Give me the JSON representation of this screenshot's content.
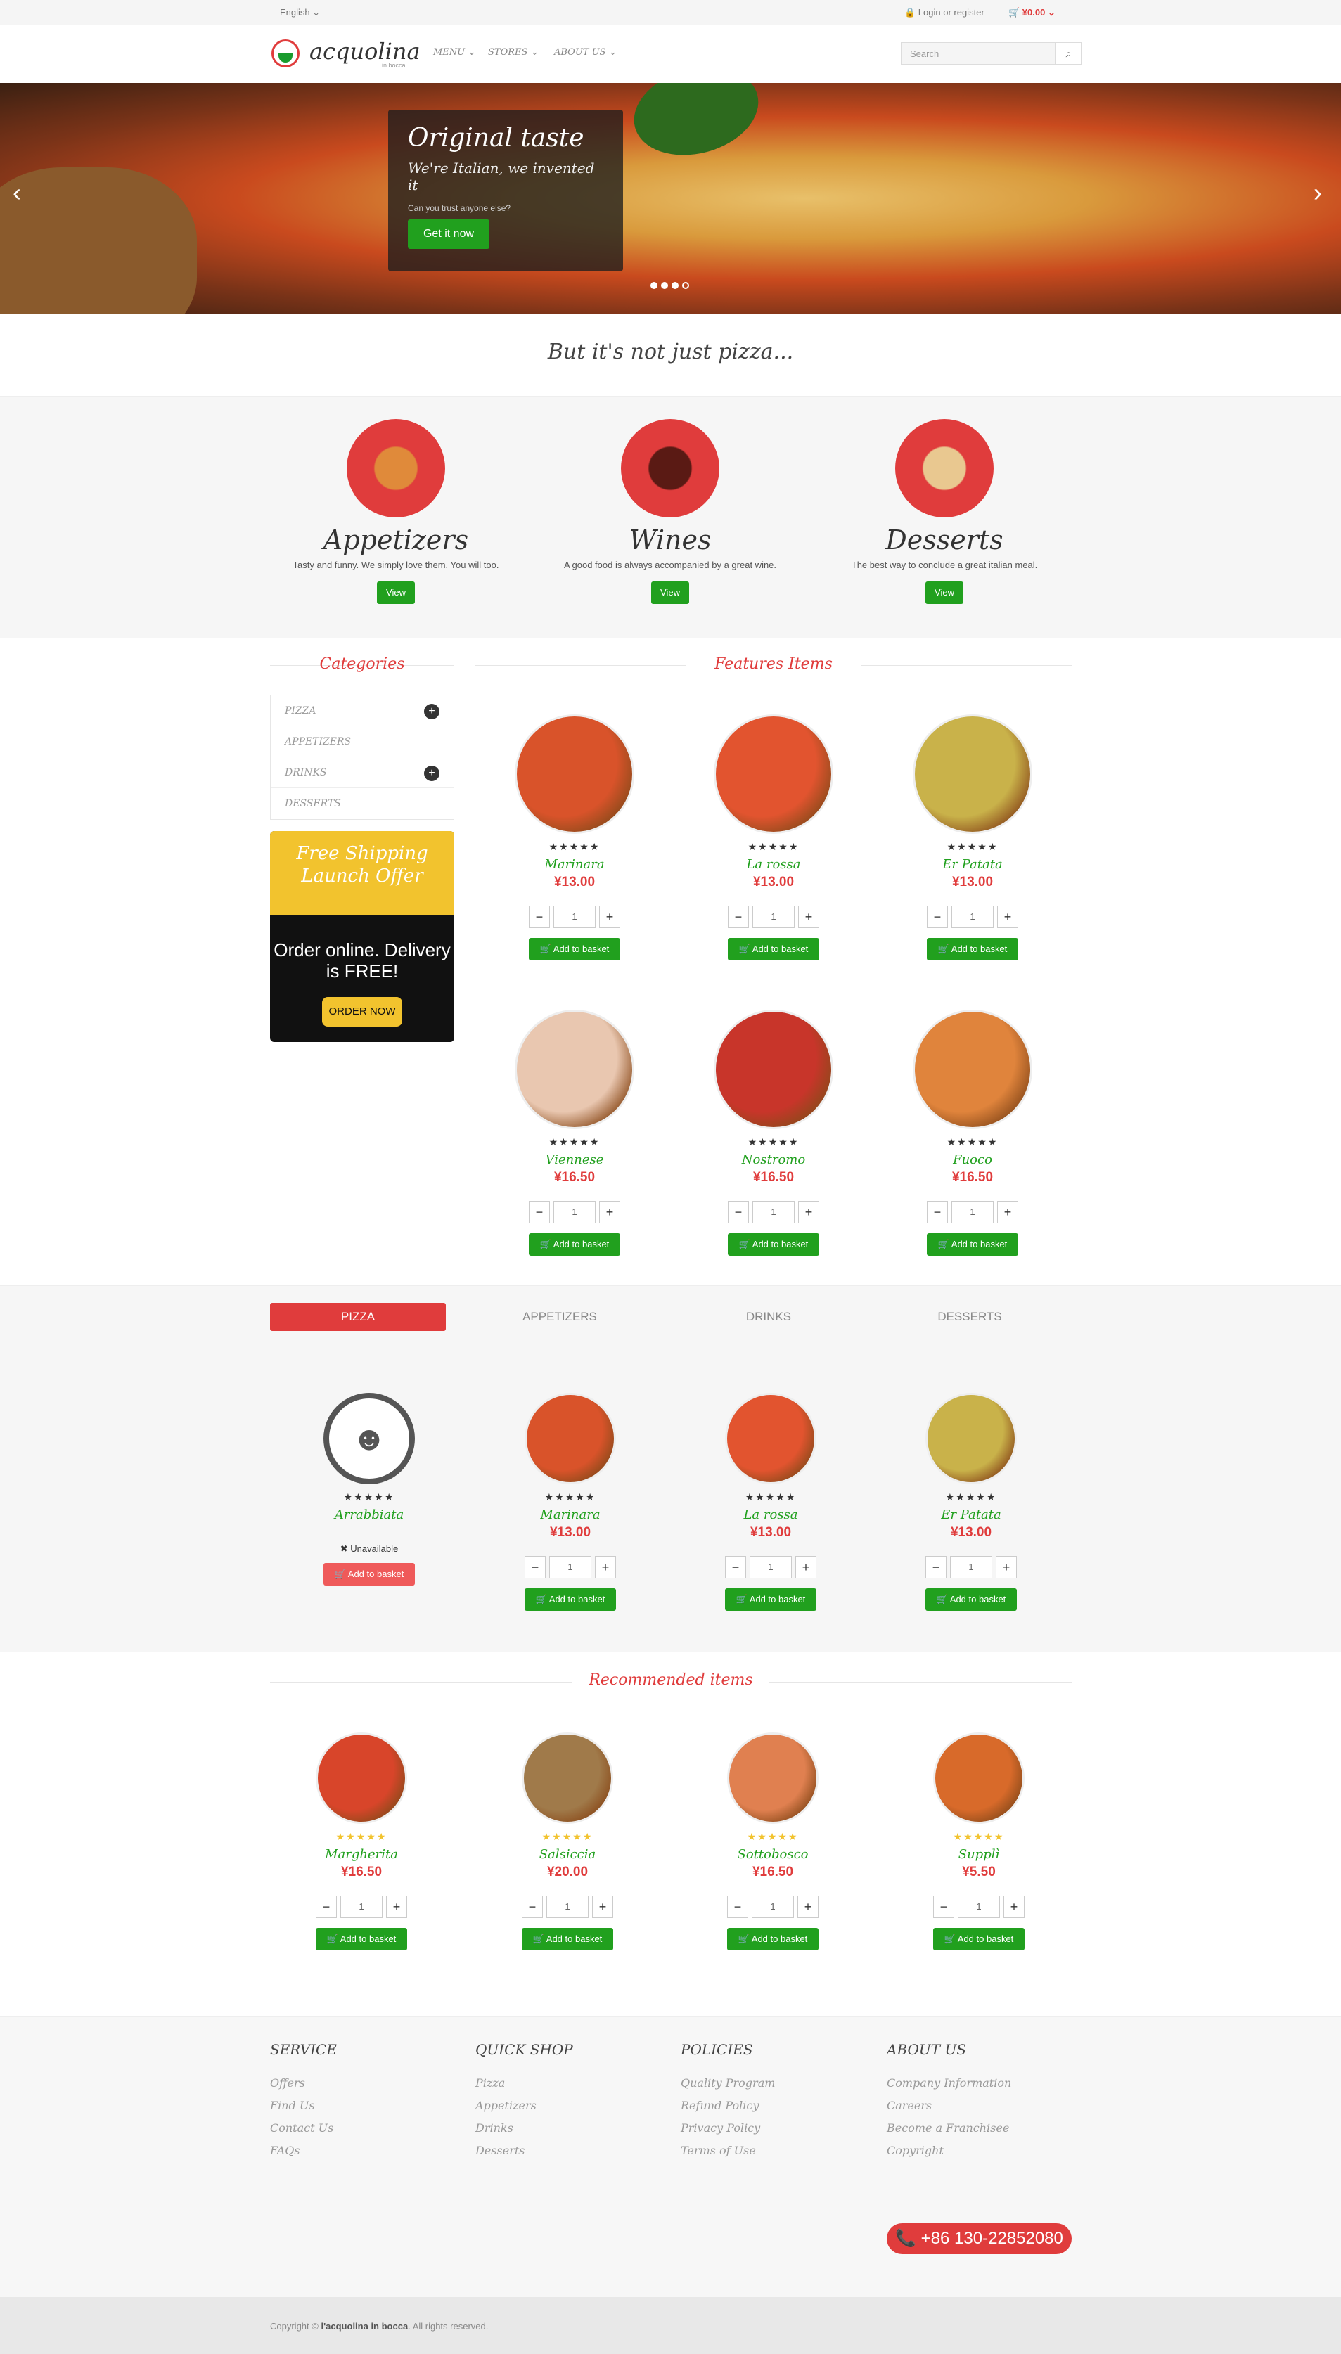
{
  "topbar": {
    "language": "English ⌄",
    "login": "🔒 Login or register",
    "cart": "🛒 ¥0.00 ⌄"
  },
  "header": {
    "logo": "acquolina",
    "logo_sub": "in bocca",
    "nav": [
      "MENU ⌄",
      "STORES ⌄",
      "ABOUT US ⌄"
    ],
    "search_placeholder": "Search"
  },
  "hero": {
    "title": "Original taste",
    "subtitle": "We're Italian, we invented it",
    "small": "Can you trust anyone else?",
    "cta": "Get it now"
  },
  "tagline": "But it's not just pizza...",
  "categories_showcase": [
    {
      "name": "Appetizers",
      "desc": "Tasty and funny. We simply love them. You will too.",
      "button": "View"
    },
    {
      "name": "Wines",
      "desc": "A good food is always accompanied by a great wine.",
      "button": "View"
    },
    {
      "name": "Desserts",
      "desc": "The best way to conclude a great italian meal.",
      "button": "View"
    }
  ],
  "sidebar": {
    "title": "Categories",
    "items": [
      "PIZZA",
      "APPETIZERS",
      "DRINKS",
      "DESSERTS"
    ],
    "promo": {
      "top": "Free Shipping Launch Offer",
      "mid": "Order online. Delivery is FREE!",
      "button": "ORDER NOW"
    }
  },
  "features": {
    "title": "Features Items",
    "items": [
      {
        "name": "Marinara",
        "price": "¥13.00",
        "qty": "1",
        "button": "🛒 Add to basket",
        "stars": "★★★★★",
        "color": "#d9532a"
      },
      {
        "name": "La rossa",
        "price": "¥13.00",
        "qty": "1",
        "button": "🛒 Add to basket",
        "stars": "★★★★★",
        "color": "#e2542f"
      },
      {
        "name": "Er Patata",
        "price": "¥13.00",
        "qty": "1",
        "button": "🛒 Add to basket",
        "stars": "★★★★★",
        "color": "#c9b24a"
      },
      {
        "name": "Viennese",
        "price": "¥16.50",
        "qty": "1",
        "button": "🛒 Add to basket",
        "stars": "★★★★★",
        "color": "#e9c7b0"
      },
      {
        "name": "Nostromo",
        "price": "¥16.50",
        "qty": "1",
        "button": "🛒 Add to basket",
        "stars": "★★★★★",
        "color": "#c8352a"
      },
      {
        "name": "Fuoco",
        "price": "¥16.50",
        "qty": "1",
        "button": "🛒 Add to basket",
        "stars": "★★★★★",
        "color": "#e0843c"
      }
    ]
  },
  "tabs": [
    "PIZZA",
    "APPETIZERS",
    "DRINKS",
    "DESSERTS"
  ],
  "tab_items": [
    {
      "name": "Arrabbiata",
      "stars": "★★★★★",
      "unavailable": "✖ Unavailable",
      "button": "🛒 Add to basket"
    },
    {
      "name": "Marinara",
      "price": "¥13.00",
      "qty": "1",
      "stars": "★★★★★",
      "button": "🛒 Add to basket",
      "color": "#d9532a"
    },
    {
      "name": "La rossa",
      "price": "¥13.00",
      "qty": "1",
      "stars": "★★★★★",
      "button": "🛒 Add to basket",
      "color": "#e2542f"
    },
    {
      "name": "Er Patata",
      "price": "¥13.00",
      "qty": "1",
      "stars": "★★★★★",
      "button": "🛒 Add to basket",
      "color": "#c9b24a"
    }
  ],
  "recommended": {
    "title": "Recommended items",
    "items": [
      {
        "name": "Margherita",
        "price": "¥16.50",
        "qty": "1",
        "stars": "★★★★★",
        "button": "🛒 Add to basket",
        "color": "#d8452a"
      },
      {
        "name": "Salsiccia",
        "price": "¥20.00",
        "qty": "1",
        "stars": "★★★★★",
        "button": "🛒 Add to basket",
        "color": "#a07a4a"
      },
      {
        "name": "Sottobosco",
        "price": "¥16.50",
        "qty": "1",
        "stars": "★★★★★",
        "button": "🛒 Add to basket",
        "color": "#e08050"
      },
      {
        "name": "Supplì",
        "price": "¥5.50",
        "qty": "1",
        "stars": "★★★★★",
        "button": "🛒 Add to basket",
        "color": "#d86a2a"
      }
    ]
  },
  "footer": {
    "cols": [
      {
        "title": "SERVICE",
        "links": [
          "Offers",
          "Find Us",
          "Contact Us",
          "FAQs"
        ]
      },
      {
        "title": "QUICK SHOP",
        "links": [
          "Pizza",
          "Appetizers",
          "Drinks",
          "Desserts"
        ]
      },
      {
        "title": "POLICIES",
        "links": [
          "Quality Program",
          "Refund Policy",
          "Privacy Policy",
          "Terms of Use"
        ]
      },
      {
        "title": "ABOUT US",
        "links": [
          "Company Information",
          "Careers",
          "Become a Franchisee",
          "Copyright"
        ]
      }
    ],
    "phone": "📞 +86 130-22852080",
    "copyright_pre": "Copyright © ",
    "copyright_brand": "l'acquolina in bocca",
    "copyright_post": ". All rights reserved."
  },
  "colors": {
    "accent": "#e03c3c",
    "green": "#21a01e",
    "yellow": "#f2c32e"
  }
}
